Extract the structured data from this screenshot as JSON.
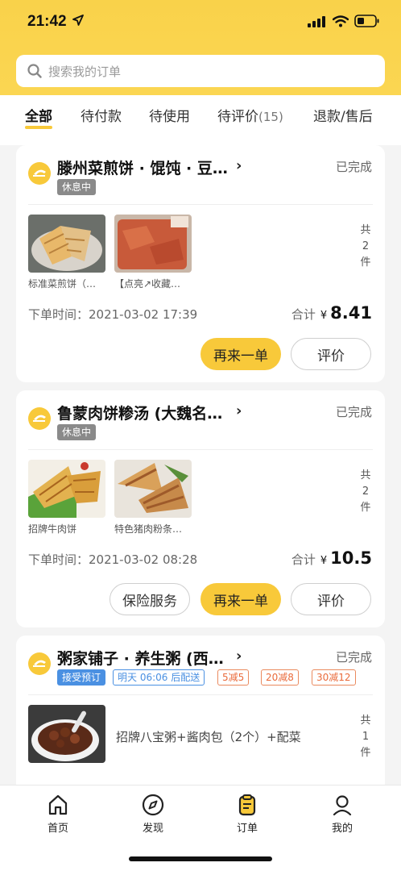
{
  "status_bar": {
    "time": "21:42"
  },
  "search": {
    "placeholder": "搜索我的订单"
  },
  "tabs": [
    {
      "label": "全部"
    },
    {
      "label": "待付款"
    },
    {
      "label": "待使用"
    },
    {
      "label": "待评价",
      "count": "(15)"
    },
    {
      "label": "退款/售后"
    }
  ],
  "orders": [
    {
      "shop": "滕州菜煎饼 · 馄饨 · 豆…",
      "status": "已完成",
      "tag": "休息中",
      "items": [
        "标准菜煎饼（…",
        "【点亮↗收藏…"
      ],
      "count": [
        "共",
        "2",
        "件"
      ],
      "time": "下单时间：2021-03-02 17:39",
      "total_label": "合计",
      "currency": "¥",
      "total": "8.41",
      "buttons": [
        "再来一单",
        "评价"
      ]
    },
    {
      "shop": "鲁蒙肉饼糁汤 (大魏名…",
      "status": "已完成",
      "tag": "休息中",
      "items": [
        "招牌牛肉饼",
        "特色猪肉粉条…"
      ],
      "count": [
        "共",
        "2",
        "件"
      ],
      "time": "下单时间：2021-03-02 08:28",
      "total_label": "合计",
      "currency": "¥",
      "total": "10.5",
      "buttons": [
        "保险服务",
        "再来一单",
        "评价"
      ]
    },
    {
      "shop": "粥家铺子 · 养生粥 (西…",
      "status": "已完成",
      "tags": [
        "接受预订",
        "明天 06:06 后配送",
        "5减5",
        "20减8",
        "30减12"
      ],
      "item": "招牌八宝粥+酱肉包（2个）+配菜",
      "count": [
        "共",
        "1",
        "件"
      ]
    }
  ],
  "nav": [
    {
      "label": "首页"
    },
    {
      "label": "发现"
    },
    {
      "label": "订单"
    },
    {
      "label": "我的"
    }
  ],
  "colors": {
    "accent": "#f8c93a",
    "blue": "#4a90e2",
    "discount": "#ea6b3b"
  }
}
